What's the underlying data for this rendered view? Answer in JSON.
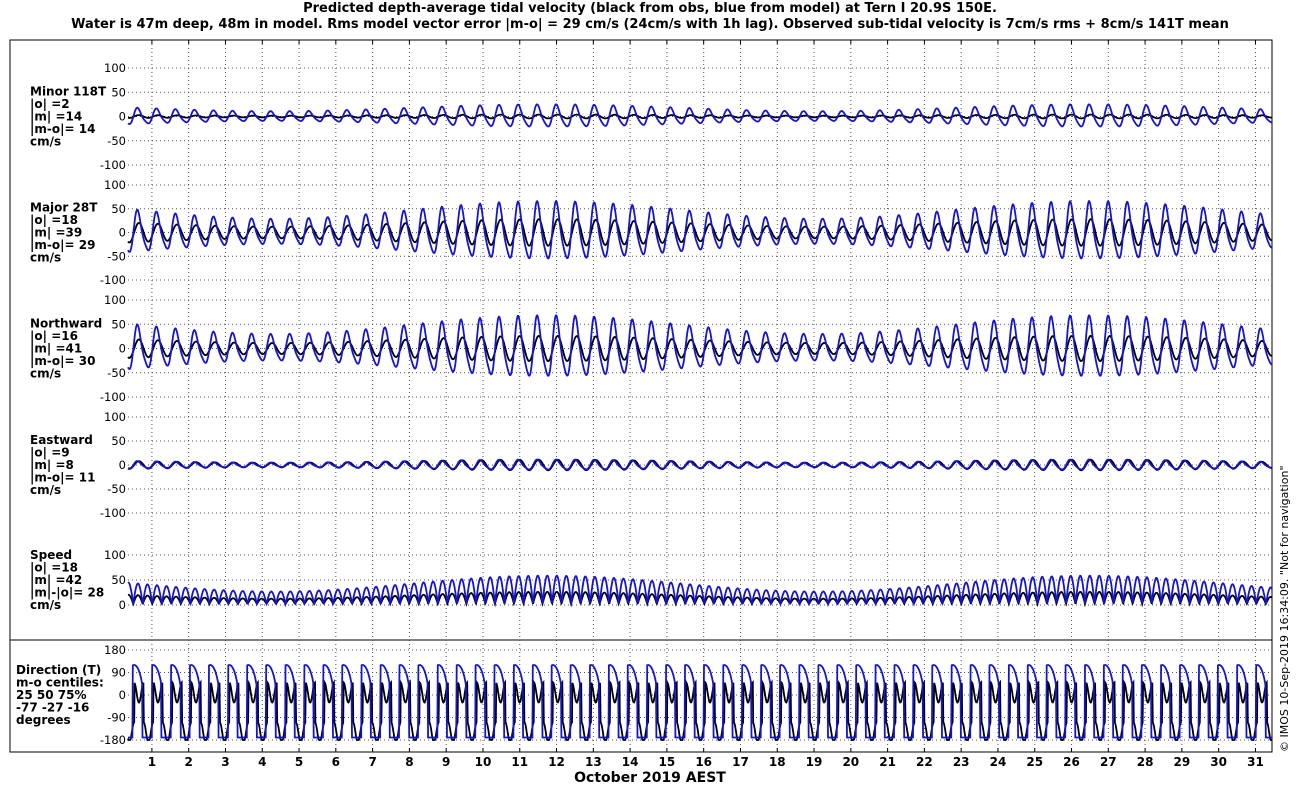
{
  "title_line1": "Predicted depth-average tidal velocity (black from obs, blue from model) at Tern I 20.9S 150E.",
  "title_line2": "Water is 47m deep, 48m in model. Rms model vector error |m-o| = 29 cm/s (24cm/s with 1h lag). Observed sub-tidal velocity is 7cm/s rms + 8cm/s 141T mean",
  "xlabel": "October 2019 AEST",
  "credit": "© IMOS 10-Sep-2019 16:34:09.  \"Not for navigation\"",
  "colors": {
    "obs": "#000000",
    "model": "#1515d0",
    "grid": "#555555"
  },
  "chart_data": {
    "type": "line",
    "x_unit": "day of October 2019",
    "xlim": [
      0.35,
      31.45
    ],
    "x_ticks": [
      "1",
      "2",
      "3",
      "4",
      "5",
      "6",
      "7",
      "8",
      "9",
      "10",
      "11",
      "12",
      "13",
      "14",
      "15",
      "16",
      "17",
      "18",
      "19",
      "20",
      "21",
      "22",
      "23",
      "24",
      "25",
      "26",
      "27",
      "28",
      "29",
      "30",
      "31"
    ],
    "grid": true,
    "series_legend": {
      "obs": "black from obs",
      "model": "blue from model"
    },
    "panels": [
      {
        "key": "minor",
        "label_lines": [
          "Minor 118T",
          "|o| =2",
          "|m| =14",
          "|m-o|= 14",
          "cm/s"
        ],
        "ylim": [
          -100,
          100
        ],
        "y_ticks": [
          "100",
          "50",
          "0",
          "-50",
          "-100"
        ],
        "obs_amplitude": 4,
        "model_amplitude": 22,
        "model_semidiurnal_phase_hours": 0
      },
      {
        "key": "major",
        "label_lines": [
          "Major 28T",
          "|o| =18",
          "|m| =39",
          "|m-o|= 29",
          "cm/s"
        ],
        "ylim": [
          -100,
          100
        ],
        "y_ticks": [
          "100",
          "50",
          "0",
          "-50",
          "-100"
        ],
        "obs_amplitude": 28,
        "model_amplitude": 58
      },
      {
        "key": "northward",
        "label_lines": [
          "Northward",
          "|o| =16",
          "|m| =41",
          "|m-o|= 30",
          "cm/s"
        ],
        "ylim": [
          -100,
          100
        ],
        "y_ticks": [
          "100",
          "50",
          "0",
          "-50",
          "-100"
        ],
        "obs_amplitude": 26,
        "model_amplitude": 60
      },
      {
        "key": "eastward",
        "label_lines": [
          "Eastward",
          "|o| =9",
          "|m| =8",
          "|m-o|= 11",
          "cm/s"
        ],
        "ylim": [
          -100,
          100
        ],
        "y_ticks": [
          "100",
          "50",
          "0",
          "-50",
          "-100"
        ],
        "obs_amplitude": 11,
        "model_amplitude": 10
      },
      {
        "key": "speed",
        "label_lines": [
          "Speed",
          "|o| =18",
          "|m| =42",
          "|m|-|o|= 28",
          "cm/s"
        ],
        "ylim": [
          0,
          100
        ],
        "y_ticks": [
          "100",
          "50",
          "0"
        ],
        "obs_amplitude": 18,
        "model_amplitude": 42
      },
      {
        "key": "direction",
        "label_lines": [
          "Direction (T)",
          "m-o centiles:",
          "25  50  75%",
          "-77 -27 -16",
          "degrees"
        ],
        "ylim": [
          -180,
          180
        ],
        "y_ticks": [
          "180",
          "90",
          "0",
          "-90",
          "-180"
        ],
        "m_minus_o_centiles_deg": {
          "25": -77,
          "50": -27,
          "75": -16
        }
      }
    ]
  }
}
